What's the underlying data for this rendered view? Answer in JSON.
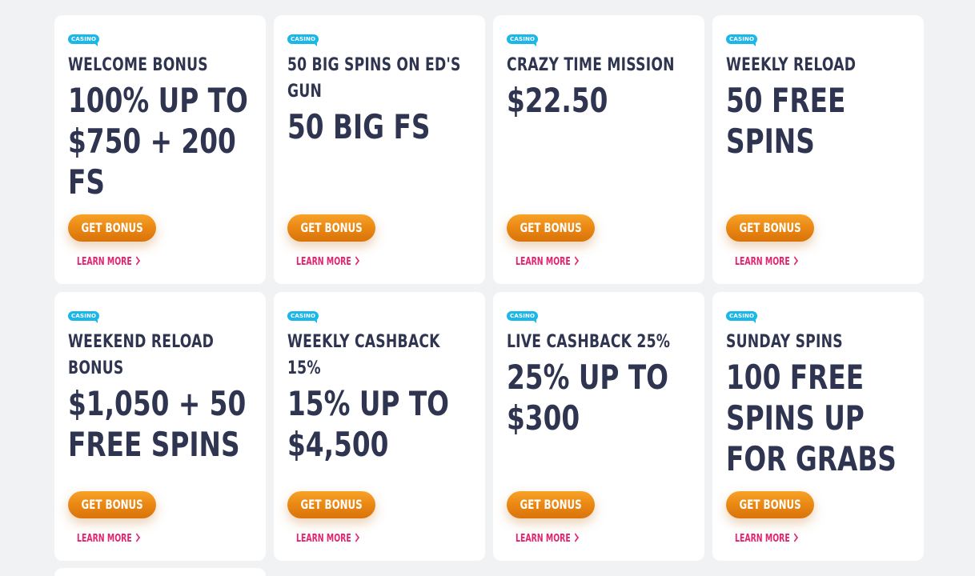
{
  "cards": [
    {
      "tag": "CASINO",
      "title": "WELCOME BONUS",
      "amount": "100% UP TO $750 + 200 FS",
      "button": "GET BONUS",
      "learn": "LEARN MORE"
    },
    {
      "tag": "CASINO",
      "title": "50 BIG SPINS ON ED'S GUN",
      "amount": "50 BIG FS",
      "button": "GET BONUS",
      "learn": "LEARN MORE"
    },
    {
      "tag": "CASINO",
      "title": "CRAZY TIME MISSION",
      "amount": "$22.50",
      "button": "GET BONUS",
      "learn": "LEARN MORE"
    },
    {
      "tag": "CASINO",
      "title": "WEEKLY RELOAD",
      "amount": "50 FREE SPINS",
      "button": "GET BONUS",
      "learn": "LEARN MORE"
    },
    {
      "tag": "CASINO",
      "title": "WEEKEND RELOAD BONUS",
      "amount": "$1,050 + 50 FREE SPINS",
      "button": "GET BONUS",
      "learn": "LEARN MORE"
    },
    {
      "tag": "CASINO",
      "title": "WEEKLY CASHBACK 15%",
      "amount": "15% UP TO $4,500",
      "button": "GET BONUS",
      "learn": "LEARN MORE"
    },
    {
      "tag": "CASINO",
      "title": "LIVE CASHBACK 25%",
      "amount": "25% UP TO $300",
      "button": "GET BONUS",
      "learn": "LEARN MORE"
    },
    {
      "tag": "CASINO",
      "title": "SUNDAY SPINS",
      "amount": "100 FREE SPINS UP FOR GRABS",
      "button": "GET BONUS",
      "learn": "LEARN MORE"
    }
  ],
  "icons": {
    "learn_more": "chevron-right-icon"
  },
  "colors": {
    "background": "#f1f2f4",
    "card": "#ffffff",
    "tag": "#1ab7ea",
    "heading": "#2f3550",
    "button": "#e88512",
    "link": "#e4236f"
  }
}
